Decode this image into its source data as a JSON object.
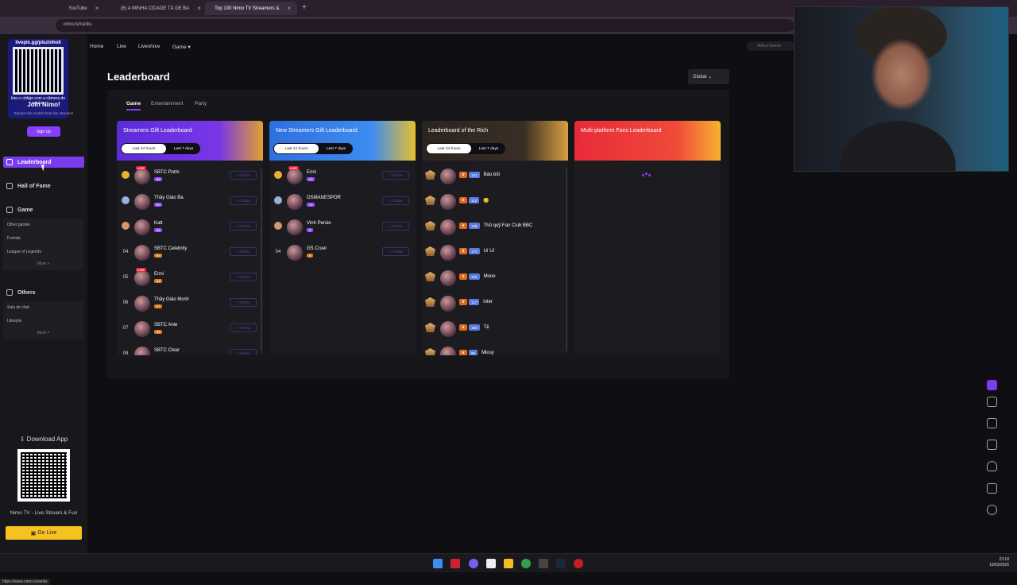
{
  "browser": {
    "tabs": [
      {
        "label": "YouTube",
        "active": false
      },
      {
        "label": "(6) A MINHA CIDADE TÁ DE BA",
        "active": false
      },
      {
        "label": "Top 100 Nimo TV Streamers &",
        "active": true
      }
    ],
    "url": "nimo.tv/ranks"
  },
  "sidebar": {
    "promo_qr": {
      "url": "livepix.gg/pluzinholl",
      "caption": "leia o código com a câmera do celular."
    },
    "join_title": "Join Nimo!",
    "join_subtitle": "Explore the world's best live streams!",
    "signup": "Sign Up",
    "nav": {
      "leaderboard": "Leaderboard",
      "hall_of_fame": "Hall of Fame",
      "game": "Game",
      "others": "Others"
    },
    "game_items": [
      "Other games",
      "Fortnite",
      "League of Legends"
    ],
    "game_more": "More >",
    "other_items": [
      "Sala de chat",
      "Lifestyle"
    ],
    "other_more": "More >",
    "download_title": "Download App",
    "download_caption": "Nimo TV - Live Stream & Fun",
    "go_live": "Go Live",
    "status_url": "https://www.nimo.tv/ranks"
  },
  "topnav": {
    "items": [
      "Home",
      "Live",
      "Liveshow",
      "Game"
    ],
    "search_placeholder": "Arthur Gamer"
  },
  "main": {
    "title": "Leaderboard",
    "region": "Global",
    "tabs": [
      "Game",
      "Entertainment",
      "Party"
    ],
    "period_tabs": [
      "Last 24 hours",
      "Last 7 days"
    ],
    "follow_label": "+ Follow",
    "live_label": "LIVE"
  },
  "columns": {
    "streamers": {
      "title": "Streamers Gift Leaderboard",
      "color": "#5b2cd8",
      "rows": [
        {
          "rank": "01",
          "name": "SBTC Potm",
          "level": "58",
          "live": true
        },
        {
          "rank": "02",
          "name": "Thầy Giáo Ba",
          "level": "60",
          "live": false
        },
        {
          "rank": "03",
          "name": "Katt",
          "level": "48",
          "live": false
        },
        {
          "rank": "04",
          "name": "SBTC Celebrity",
          "level": "60",
          "live": false
        },
        {
          "rank": "05",
          "name": "Enni",
          "level": "23",
          "live": true
        },
        {
          "rank": "06",
          "name": "Thầy Giáo Mười",
          "level": "57",
          "live": false
        },
        {
          "rank": "07",
          "name": "SBTC Anie",
          "level": "55",
          "live": false
        },
        {
          "rank": "08",
          "name": "SBTC Clear",
          "level": "",
          "live": false
        }
      ]
    },
    "new_streamers": {
      "title": "New Streamers Gift Leaderboard",
      "color": "#2f6fe0",
      "rows": [
        {
          "rank": "01",
          "name": "Enni",
          "level": "23",
          "live": true
        },
        {
          "rank": "02",
          "name": "OSMANESPOR",
          "level": "12",
          "live": false
        },
        {
          "rank": "03",
          "name": "Vinh Persie",
          "level": "5",
          "live": false
        },
        {
          "rank": "04",
          "name": "GS Cruel",
          "level": "5",
          "live": false
        }
      ]
    },
    "rich": {
      "title": "Leaderboard of the Rich",
      "color": "#2a2420",
      "rows": [
        {
          "badge": "101",
          "name": "Bảo bối"
        },
        {
          "badge": "112",
          "name": "😊"
        },
        {
          "badge": "138",
          "name": "Thủ quỹ Fan Club BBC"
        },
        {
          "badge": "173",
          "name": "Uí Uí"
        },
        {
          "badge": "125",
          "name": "Mone"
        },
        {
          "badge": "117",
          "name": "inter"
        },
        {
          "badge": "160",
          "name": "Tệ"
        },
        {
          "badge": "99",
          "name": "Miusy"
        }
      ]
    },
    "fans": {
      "title": "Multi-platform Fans Leaderboard",
      "color": "#e82a3a"
    }
  },
  "taskbar": {
    "time": "23:18",
    "date": "10/03/2026"
  }
}
